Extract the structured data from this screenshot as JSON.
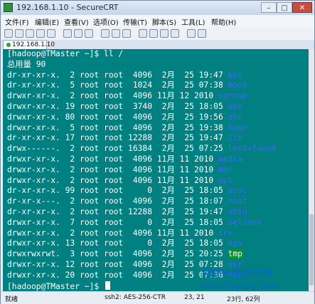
{
  "window": {
    "title": "192.168.1.10 - SecureCRT"
  },
  "menu": [
    "文件(F)",
    "编辑(E)",
    "查看(V)",
    "选项(O)",
    "传输(T)",
    "脚本(S)",
    "工具(L)",
    "帮助(H)"
  ],
  "tab": {
    "label": "192.168.1.10"
  },
  "terminal": {
    "lines": [
      "[hadoop@TMaster ~]$ ll /",
      "总用量 90",
      "dr-xr-xr-x.  2 root root  4096  2月  25 19:47 ",
      "dr-xr-xr-x.  5 root root  1024  2月  25 07:38 ",
      "drwxr-xr-x.  2 root root  4096 11月 12 2010 ",
      "drwxr-xr-x. 19 root root  3740  2月  25 18:05 ",
      "drwxr-xr-x. 80 root root  4096  2月  25 19:56 ",
      "drwxr-xr-x.  5 root root  4096  2月  25 19:38 ",
      "dr-xr-xr-x. 17 root root 12288  2月  25 19:47 ",
      "drwx------.  2 root root 16384  2月  25 07:25 ",
      "drwxr-xr-x.  2 root root  4096 11月 11 2010 ",
      "drwxr-xr-x.  2 root root  4096 11月 11 2010 ",
      "drwxr-xr-x.  2 root root  4096 11月 11 2010 ",
      "dr-xr-xr-x. 99 root root     0  2月  25 18:05 ",
      "dr-xr-x---.  2 root root  4096  2月  25 18:07 ",
      "dr-xr-xr-x.  2 root root 12288  2月  25 19:47 ",
      "drwxr-xr-x.  7 root root     0  2月  25 18:05 ",
      "drwxr-xr-x.  2 root root  4096 11月 11 2010 ",
      "drwxr-xr-x. 13 root root     0  2月  25 18:05 ",
      "drwxrwxrwt.  3 root root  4096  2月  25 20:25 ",
      "drwxr-xr-x. 12 root root  4096  2月  25 07:28 ",
      "drwxr-xr-x. 20 root root  4096  2月  25 07:36 ",
      "[hadoop@TMaster ~]$ "
    ],
    "names": [
      "bin",
      "boot",
      "cgroup",
      "dev",
      "etc",
      "home",
      "lib",
      "lost+found",
      "media",
      "mnt",
      "opt",
      "proc",
      "root",
      "sbin",
      "selinux",
      "srv",
      "sys",
      "tmp",
      "usr",
      "var"
    ]
  },
  "status": {
    "ready": "就绪",
    "cipher": "ssh2: AES-256-CTR",
    "cursor_pos": "23, 21",
    "size": "23行, 62列"
  },
  "watermark": {
    "line1": "鹏鹏电脑知识网",
    "line2": "www.flypeng.com"
  },
  "colors": {
    "terminal_bg": "#008080",
    "terminal_fg": "#ffffff",
    "dirname": "#3f66ff",
    "tmp_highlight": "#0b8f2f"
  }
}
